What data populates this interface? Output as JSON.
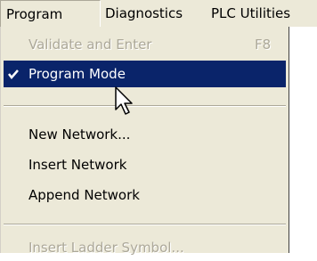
{
  "menubar": {
    "items": [
      {
        "label": "Program"
      },
      {
        "label": "Diagnostics"
      },
      {
        "label": "PLC Utilities"
      }
    ]
  },
  "menu": {
    "items": [
      {
        "label": "Validate and Enter",
        "shortcut": "F8",
        "state": "disabled"
      },
      {
        "label": "Program Mode",
        "state": "checked-highlighted",
        "check_icon": "checkmark-icon"
      },
      {
        "label": "New Network...",
        "state": "enabled"
      },
      {
        "label": "Insert Network",
        "state": "enabled"
      },
      {
        "label": "Append Network",
        "state": "enabled"
      },
      {
        "label": "Insert Ladder Symbol...",
        "state": "disabled"
      }
    ]
  },
  "colors": {
    "menu_background": "#ece9d8",
    "highlight": "#0a246a",
    "disabled_text": "#aca899"
  },
  "icons": {
    "cursor": "mouse-pointer-icon"
  }
}
